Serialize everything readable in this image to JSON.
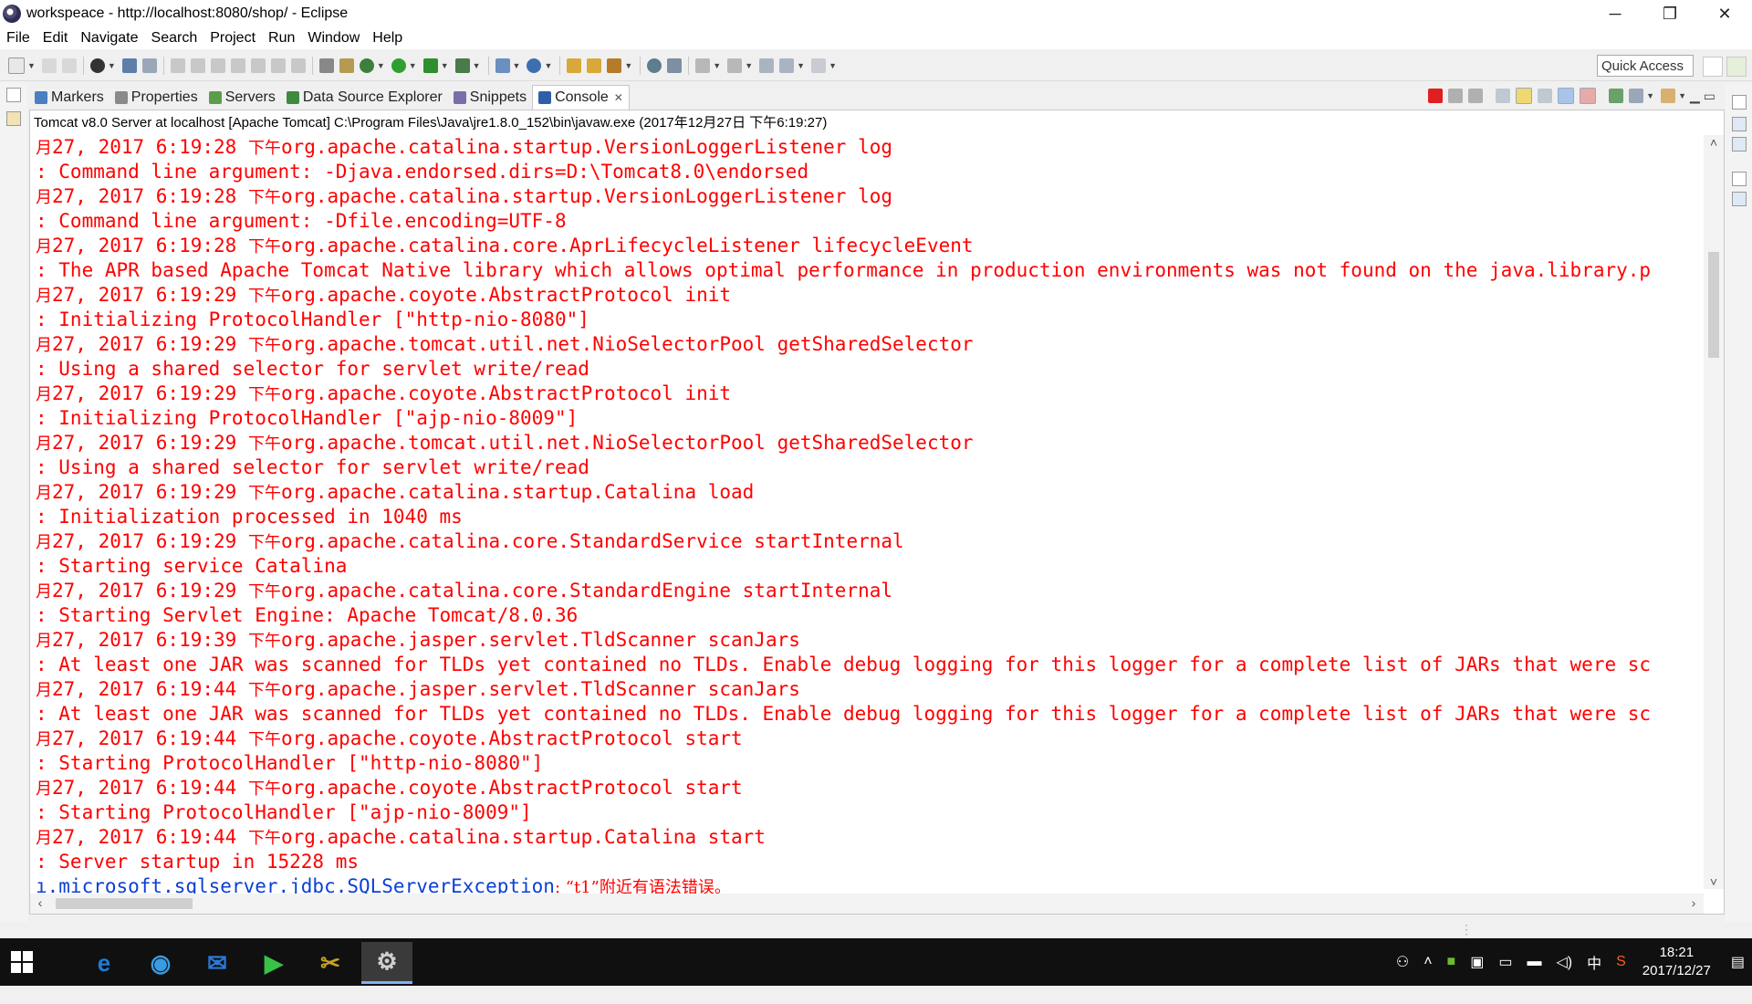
{
  "window": {
    "title": "workspeace - http://localhost:8080/shop/ - Eclipse",
    "controls": [
      "─",
      "❐",
      "✕"
    ]
  },
  "menu": [
    "File",
    "Edit",
    "Navigate",
    "Search",
    "Project",
    "Run",
    "Window",
    "Help"
  ],
  "toolbar": {
    "quick_access": "Quick Access"
  },
  "view_tabs": [
    {
      "label": "Markers",
      "icon": "markers-icon",
      "color": "#4a7fc1"
    },
    {
      "label": "Properties",
      "icon": "properties-icon",
      "color": "#8a8a8a"
    },
    {
      "label": "Servers",
      "icon": "servers-icon",
      "color": "#5a9e4b"
    },
    {
      "label": "Data Source Explorer",
      "icon": "data-source-icon",
      "color": "#3e8a3e"
    },
    {
      "label": "Snippets",
      "icon": "snippets-icon",
      "color": "#7b6ea8"
    },
    {
      "label": "Console",
      "icon": "console-icon",
      "color": "#2f5fa8",
      "active": true
    }
  ],
  "console": {
    "header": "Tomcat v8.0 Server at localhost [Apache Tomcat] C:\\Program Files\\Java\\jre1.8.0_152\\bin\\javaw.exe (2017年12月27日 下午6:19:27)",
    "text_color": "#ff0000",
    "lines": [
      {
        "cjk1": "月",
        "text": "27, 2017 6:19:28 ",
        "cjk2": "下午",
        "rest": "org.apache.catalina.startup.VersionLoggerListener log"
      },
      {
        "text": ": Command line argument: -Djava.endorsed.dirs=D:\\Tomcat8.0\\endorsed"
      },
      {
        "cjk1": "月",
        "text": "27, 2017 6:19:28 ",
        "cjk2": "下午",
        "rest": "org.apache.catalina.startup.VersionLoggerListener log"
      },
      {
        "text": ": Command line argument: -Dfile.encoding=UTF-8"
      },
      {
        "cjk1": "月",
        "text": "27, 2017 6:19:28 ",
        "cjk2": "下午",
        "rest": "org.apache.catalina.core.AprLifecycleListener lifecycleEvent"
      },
      {
        "text": ": The APR based Apache Tomcat Native library which allows optimal performance in production environments was not found on the java.library.p"
      },
      {
        "cjk1": "月",
        "text": "27, 2017 6:19:29 ",
        "cjk2": "下午",
        "rest": "org.apache.coyote.AbstractProtocol init"
      },
      {
        "text": ": Initializing ProtocolHandler [\"http-nio-8080\"]"
      },
      {
        "cjk1": "月",
        "text": "27, 2017 6:19:29 ",
        "cjk2": "下午",
        "rest": "org.apache.tomcat.util.net.NioSelectorPool getSharedSelector"
      },
      {
        "text": ": Using a shared selector for servlet write/read"
      },
      {
        "cjk1": "月",
        "text": "27, 2017 6:19:29 ",
        "cjk2": "下午",
        "rest": "org.apache.coyote.AbstractProtocol init"
      },
      {
        "text": ": Initializing ProtocolHandler [\"ajp-nio-8009\"]"
      },
      {
        "cjk1": "月",
        "text": "27, 2017 6:19:29 ",
        "cjk2": "下午",
        "rest": "org.apache.tomcat.util.net.NioSelectorPool getSharedSelector"
      },
      {
        "text": ": Using a shared selector for servlet write/read"
      },
      {
        "cjk1": "月",
        "text": "27, 2017 6:19:29 ",
        "cjk2": "下午",
        "rest": "org.apache.catalina.startup.Catalina load"
      },
      {
        "text": ": Initialization processed in 1040 ms"
      },
      {
        "cjk1": "月",
        "text": "27, 2017 6:19:29 ",
        "cjk2": "下午",
        "rest": "org.apache.catalina.core.StandardService startInternal"
      },
      {
        "text": ": Starting service Catalina"
      },
      {
        "cjk1": "月",
        "text": "27, 2017 6:19:29 ",
        "cjk2": "下午",
        "rest": "org.apache.catalina.core.StandardEngine startInternal"
      },
      {
        "text": ": Starting Servlet Engine: Apache Tomcat/8.0.36"
      },
      {
        "cjk1": "月",
        "text": "27, 2017 6:19:39 ",
        "cjk2": "下午",
        "rest": "org.apache.jasper.servlet.TldScanner scanJars"
      },
      {
        "text": ": At least one JAR was scanned for TLDs yet contained no TLDs. Enable debug logging for this logger for a complete list of JARs that were sc"
      },
      {
        "cjk1": "月",
        "text": "27, 2017 6:19:44 ",
        "cjk2": "下午",
        "rest": "org.apache.jasper.servlet.TldScanner scanJars"
      },
      {
        "text": ": At least one JAR was scanned for TLDs yet contained no TLDs. Enable debug logging for this logger for a complete list of JARs that were sc"
      },
      {
        "cjk1": "月",
        "text": "27, 2017 6:19:44 ",
        "cjk2": "下午",
        "rest": "org.apache.coyote.AbstractProtocol start"
      },
      {
        "text": ": Starting ProtocolHandler [\"http-nio-8080\"]"
      },
      {
        "cjk1": "月",
        "text": "27, 2017 6:19:44 ",
        "cjk2": "下午",
        "rest": "org.apache.coyote.AbstractProtocol start"
      },
      {
        "text": ": Starting ProtocolHandler [\"ajp-nio-8009\"]"
      },
      {
        "cjk1": "月",
        "text": "27, 2017 6:19:44 ",
        "cjk2": "下午",
        "rest": "org.apache.catalina.startup.Catalina start"
      },
      {
        "text": ": Server startup in 15228 ms"
      }
    ],
    "last_line": {
      "link": "ı.microsoft.sqlserver.jdbc.SQLServerException",
      "message": ": “t1”附近有语法错误。"
    }
  },
  "taskbar": {
    "apps": [
      {
        "name": "edge",
        "color": "#1e7bd8",
        "glyph": "e"
      },
      {
        "name": "ie",
        "color": "#3b9be0",
        "glyph": "◉"
      },
      {
        "name": "mail",
        "color": "#2a79d9",
        "glyph": "✉"
      },
      {
        "name": "media",
        "color": "#38c247",
        "glyph": "▶"
      },
      {
        "name": "tool",
        "color": "#c9a020",
        "glyph": "✂"
      },
      {
        "name": "eclipse",
        "color": "#cfcfcf",
        "glyph": "⚙",
        "active": true
      }
    ],
    "tray_ime": "中",
    "clock_time": "18:21",
    "clock_date": "2017/12/27"
  }
}
